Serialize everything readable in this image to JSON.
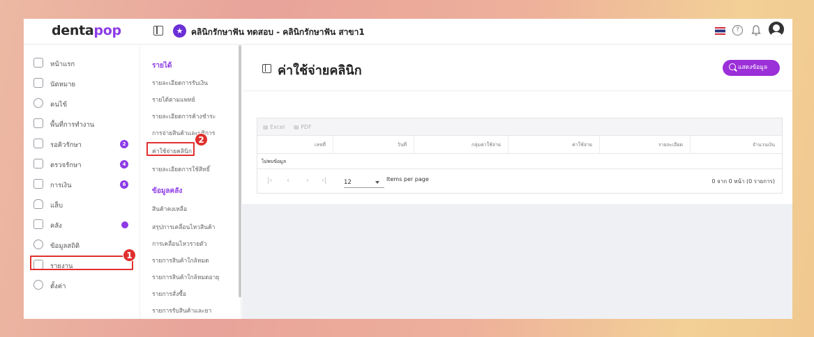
{
  "app": {
    "logo_main": "denta",
    "logo_accent": "pop",
    "clinic_title": "คลินิกรักษาฟัน ทดสอบ - คลินิกรักษาฟัน สาขา1",
    "clinic_badge": "★",
    "help_glyph": "?"
  },
  "sidebar": {
    "items": [
      {
        "label": "หน้าแรก",
        "icon": "home-icon"
      },
      {
        "label": "นัดหมาย",
        "icon": "calendar-icon"
      },
      {
        "label": "คนไข้",
        "icon": "user-icon"
      },
      {
        "label": "พื้นที่การทำงาน",
        "icon": "workspace-icon"
      },
      {
        "label": "รอคิวรักษา",
        "icon": "chair-icon",
        "badge": "2"
      },
      {
        "label": "ตรวจรักษา",
        "icon": "treatment-icon",
        "badge": "4"
      },
      {
        "label": "การเงิน",
        "icon": "money-icon",
        "badge": "6"
      },
      {
        "label": "แล็บ",
        "icon": "tooth-icon"
      },
      {
        "label": "คลัง",
        "icon": "inventory-icon",
        "dot": true
      },
      {
        "label": "ข้อมูลสถิติ",
        "icon": "stats-icon"
      },
      {
        "label": "รายงาน",
        "icon": "report-icon",
        "active": true
      },
      {
        "label": "ตั้งค่า",
        "icon": "settings-icon"
      }
    ]
  },
  "submenu": {
    "section_income": "รายได้",
    "income_links": [
      "รายละเอียดการรับเงิน",
      "รายได้ตามแพทย์",
      "รายละเอียดการค้างชำระ",
      "การจ่ายสินค้าและบริการ",
      "ค่าใช้จ่ายคลินิก",
      "รายละเอียดการใช้สิทธิ์"
    ],
    "section_stock": "ข้อมูลคลัง",
    "stock_links": [
      "สินค้าคงเหลือ",
      "สรุปการเคลื่อนไหวสินค้า",
      "การเคลื่อนไหวรายตัว",
      "รายการสินค้าใกล้หมด",
      "รายการสินค้าใกล้หมดอายุ",
      "รายการสั่งซื้อ",
      "รายการรับสินค้าและยา"
    ]
  },
  "steps": {
    "one": "1",
    "two": "2"
  },
  "page": {
    "title": "ค่าใช้จ่ายคลินิก",
    "show_button": "แสดงข้อมูล"
  },
  "table": {
    "export_excel": "Excel",
    "export_pdf": "PDF",
    "columns": [
      "เลขที่",
      "วันที่",
      "กลุ่มค่าใช้จ่าย",
      "ค่าใช้จ่าย",
      "รายละเอียด",
      "จำนวนเงิน"
    ],
    "empty_text": "ไม่พบข้อมูล",
    "items_per_page_value": "12",
    "items_per_page_label": "Items per page",
    "range_text": "0 จาก 0 หน้า (0 รายการ)"
  },
  "colors": {
    "accent": "#8d3be6",
    "button": "#9b2fd8",
    "annotation": "#e0302e"
  }
}
